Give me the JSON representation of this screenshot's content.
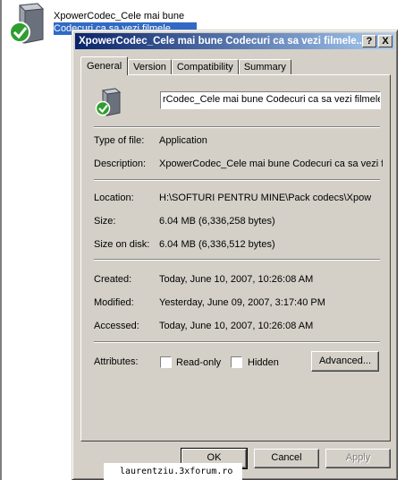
{
  "desktop": {
    "file_name_line1": "XpowerCodec_Cele mai bune",
    "file_name_line2": "Codecuri ca sa vezi filmele"
  },
  "dialog": {
    "title": "XpowerCodec_Cele mai bune Codecuri ca sa vezi filmele...",
    "help_button": "?",
    "close_button": "X",
    "tabs": [
      {
        "label": "General",
        "active": true
      },
      {
        "label": "Version"
      },
      {
        "label": "Compatibility"
      },
      {
        "label": "Summary"
      }
    ],
    "file_name_value": "rCodec_Cele mai bune Codecuri ca sa vezi filmele",
    "properties": {
      "type_label": "Type of file:",
      "type_value": "Application",
      "description_label": "Description:",
      "description_value": "XpowerCodec_Cele mai bune Codecuri ca sa vezi fi",
      "location_label": "Location:",
      "location_value": "H:\\SOFTURI PENTRU MINE\\Pack codecs\\Xpow",
      "size_label": "Size:",
      "size_value": "6.04 MB (6,336,258 bytes)",
      "size_on_disk_label": "Size on disk:",
      "size_on_disk_value": "6.04 MB (6,336,512 bytes)",
      "created_label": "Created:",
      "created_value": "Today, June 10, 2007, 10:26:08 AM",
      "modified_label": "Modified:",
      "modified_value": "Yesterday, June 09, 2007, 3:17:40 PM",
      "accessed_label": "Accessed:",
      "accessed_value": "Today, June 10, 2007, 10:26:08 AM"
    },
    "attributes": {
      "label": "Attributes:",
      "readonly_label": "Read-only",
      "hidden_label": "Hidden",
      "readonly_checked": false,
      "hidden_checked": false,
      "advanced_button": "Advanced..."
    },
    "buttons": {
      "ok": "OK",
      "cancel": "Cancel",
      "apply": "Apply"
    }
  },
  "watermark": "laurentziu.3xforum.ro",
  "colors": {
    "titlebar_start": "#0a246a",
    "titlebar_end": "#a6caf0",
    "face": "#d4d0c8",
    "selection": "#316ac5"
  },
  "icons": {
    "file": "executable-with-green-check-icon"
  }
}
